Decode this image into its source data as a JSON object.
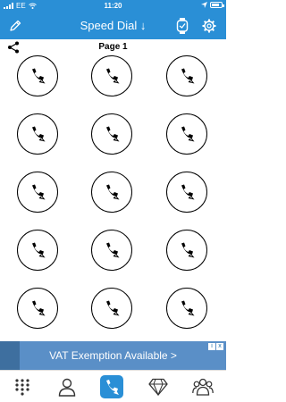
{
  "status_bar": {
    "carrier": "EE",
    "time": "11:20",
    "battery_level": 0.8,
    "icons": [
      "signal-icon",
      "wifi-icon",
      "location-icon",
      "battery-icon"
    ]
  },
  "nav": {
    "title": "Speed Dial",
    "sort_glyph": "↓",
    "left_icon": "edit-icon",
    "right_icons": [
      "watch-icon",
      "settings-icon"
    ]
  },
  "page": {
    "label": "Page 1",
    "share_icon": "share-icon"
  },
  "speed_dial": {
    "rows": 5,
    "columns": 3,
    "icon": "phone-hand-icon"
  },
  "ad": {
    "text": "VAT Exemption Available >",
    "badges": [
      "i",
      "x"
    ]
  },
  "tab_bar": {
    "tabs": [
      {
        "icon": "keypad-icon",
        "active": false
      },
      {
        "icon": "contact-icon",
        "active": false
      },
      {
        "icon": "speed-dial-icon",
        "active": true
      },
      {
        "icon": "diamond-icon",
        "active": false
      },
      {
        "icon": "group-icon",
        "active": false
      }
    ]
  },
  "colors": {
    "accent": "#2a8fd6",
    "ad_background": "#5a8fc7",
    "dial_outline": "#000000"
  }
}
